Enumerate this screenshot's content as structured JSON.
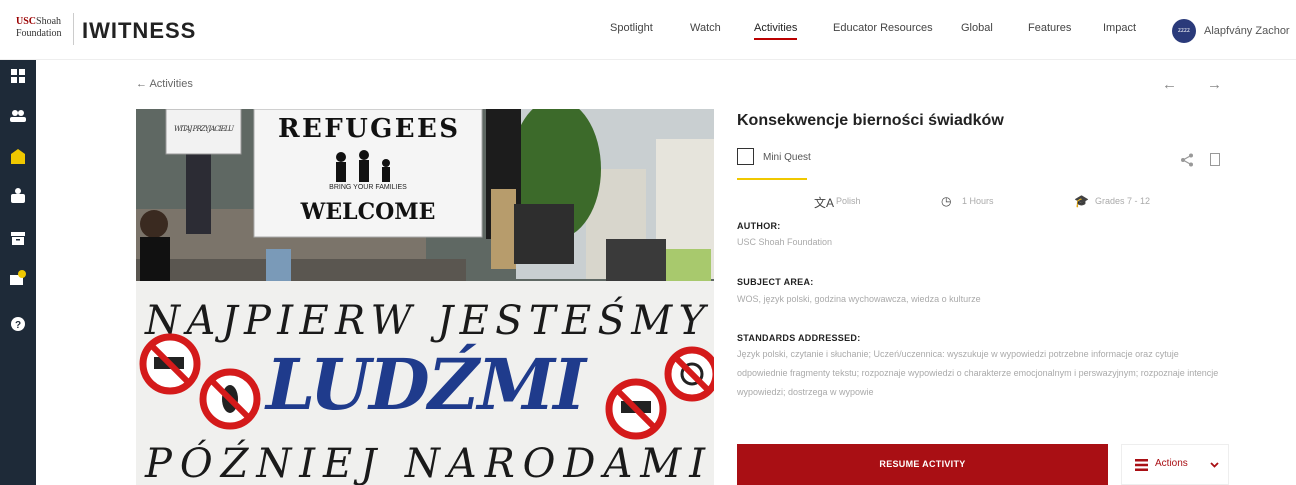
{
  "header": {
    "logo_top": "USC Shoah",
    "logo_bottom": "Foundation",
    "brand": "IWITNESS",
    "nav": [
      {
        "label": "Spotlight",
        "active": false
      },
      {
        "label": "Watch",
        "active": false
      },
      {
        "label": "Activities",
        "active": true
      },
      {
        "label": "Educator Resources",
        "active": false
      },
      {
        "label": "Global",
        "active": false
      },
      {
        "label": "Features",
        "active": false
      },
      {
        "label": "Impact",
        "active": false
      }
    ],
    "avatar_text": "zzzz",
    "user_name": "Alapfvány Zachor"
  },
  "sidebar": {
    "icons": [
      "dashboard-icon",
      "users-icon",
      "activities-icon",
      "watch-icon",
      "archive-icon",
      "messages-icon",
      "help-icon"
    ],
    "accent": "#f0c800"
  },
  "breadcrumb": {
    "back_label": "Activities"
  },
  "hero": {
    "banner_top": "REFUGEES",
    "banner_bottom": "WELCOME",
    "banner_small": "BRING YOUR FAMILIES",
    "line1": "NAJPIERW JESTEŚMY",
    "line2": "LUDŹMI",
    "line3": "PÓŹNIEJ NARODAMI",
    "sign": "WITAJ PRZYJACIELU"
  },
  "activity": {
    "title": "Konsekwencje bierności świadków",
    "type": "Mini Quest",
    "language": "Polish",
    "duration": "1 Hours",
    "grades": "Grades 7 - 12",
    "author_head": "AUTHOR:",
    "author": "USC Shoah Foundation",
    "subject_head": "SUBJECT AREA:",
    "subject": "WOS, język polski, godzina wychowawcza, wiedza o kulturze",
    "standards_head": "STANDARDS ADDRESSED:",
    "standards": "Język polski, czytanie i słuchanie; Uczeń/uczennica: wyszukuje w wypowiedzi potrzebne informacje oraz cytuje odpowiednie fragmenty tekstu; rozpoznaje wypowiedzi o charakterze emocjonalnym i perswazyjnym; rozpoznaje intencje wypowiedzi; dostrzega w wypowie",
    "resume_label": "RESUME ACTIVITY",
    "actions_label": "Actions"
  },
  "colors": {
    "brand_red": "#a90f14",
    "sidebar_bg": "#1e2a38",
    "accent_yellow": "#f0c800"
  }
}
